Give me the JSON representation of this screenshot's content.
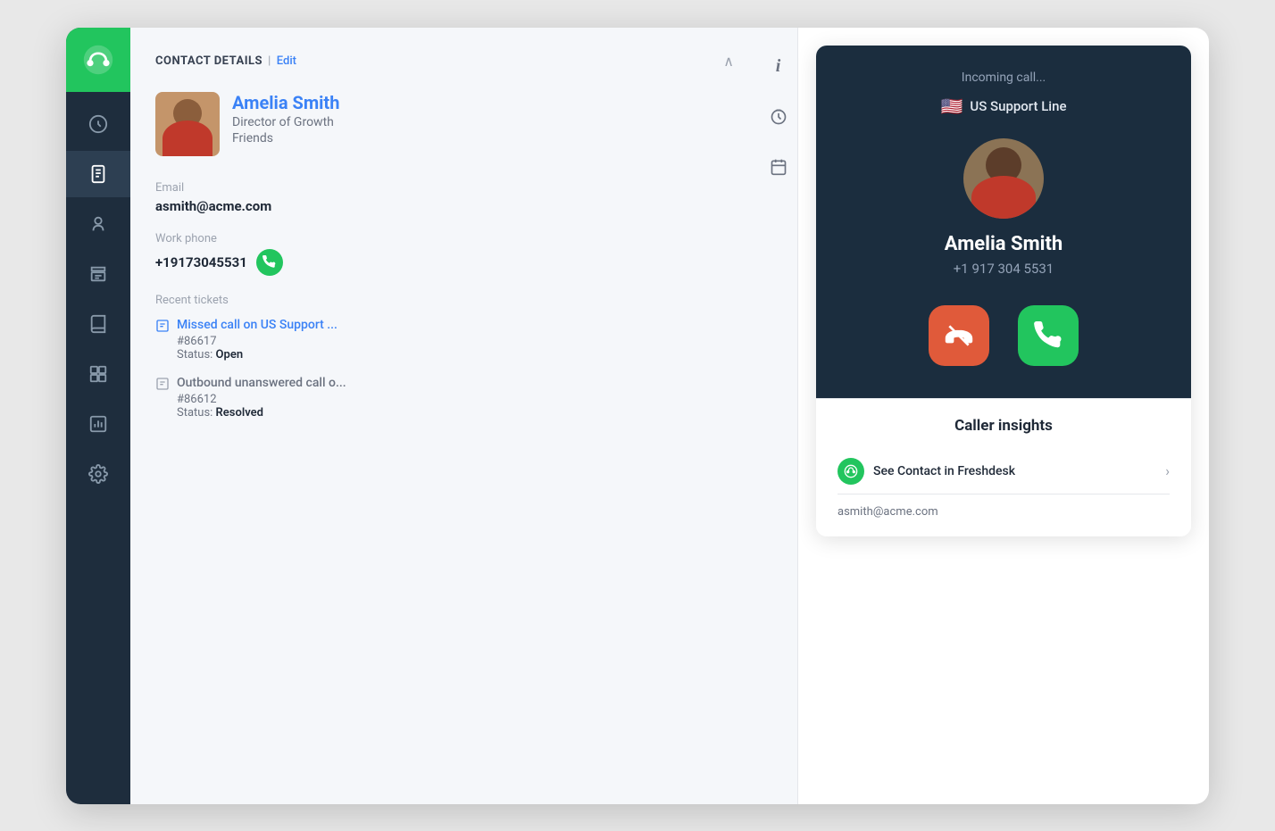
{
  "sidebar": {
    "logo_alt": "Freshdesk logo",
    "items": [
      {
        "id": "dashboard",
        "icon": "dashboard-icon",
        "label": "Dashboard"
      },
      {
        "id": "phone",
        "icon": "phone-icon",
        "label": "Phone",
        "active": true
      },
      {
        "id": "contacts",
        "icon": "contacts-icon",
        "label": "Contacts"
      },
      {
        "id": "tickets",
        "icon": "tickets-icon",
        "label": "Tickets"
      },
      {
        "id": "solutions",
        "icon": "solutions-icon",
        "label": "Solutions"
      },
      {
        "id": "reports",
        "icon": "reports-icon",
        "label": "Reports"
      },
      {
        "id": "settings",
        "icon": "settings-icon",
        "label": "Settings"
      }
    ]
  },
  "contact": {
    "section_title": "CONTACT DETAILS",
    "edit_label": "Edit",
    "name": "Amelia Smith",
    "role": "Director of Growth",
    "company": "Friends",
    "email_label": "Email",
    "email": "asmith@acme.com",
    "phone_label": "Work phone",
    "phone": "+19173045531",
    "recent_tickets_label": "Recent tickets",
    "tickets": [
      {
        "id": "ticket-1",
        "title": "Missed call on US Support ...",
        "number": "#86617",
        "status": "Open"
      },
      {
        "id": "ticket-2",
        "title": "Outbound unanswered call o...",
        "number": "#86612",
        "status": "Resolved"
      }
    ]
  },
  "icons_panel": {
    "info_icon": "i",
    "timer_icon": "timer",
    "calendar_icon": "calendar"
  },
  "incoming_call": {
    "label": "Incoming call...",
    "line_flag": "🇺🇸",
    "line_name": "US Support Line",
    "caller_name": "Amelia Smith",
    "caller_phone": "+1 917 304 5531",
    "decline_label": "Decline",
    "accept_label": "Accept"
  },
  "caller_insights": {
    "title": "Caller insights",
    "freshdesk_link_text": "See Contact in Freshdesk",
    "email": "asmith@acme.com",
    "chevron": "›"
  }
}
